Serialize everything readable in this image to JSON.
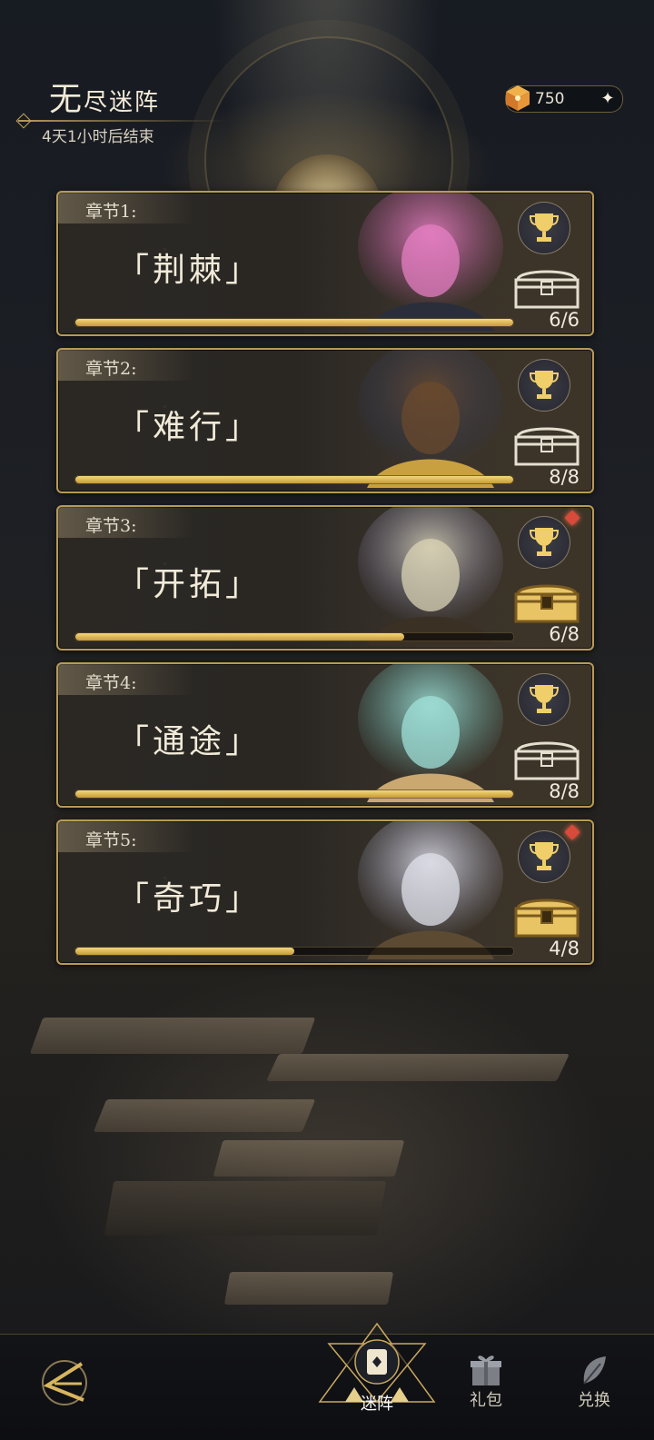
{
  "header": {
    "title_main": "无",
    "title_rest": "尽迷阵",
    "subtitle": "4天1小时后结束"
  },
  "currency": {
    "value": "750",
    "icon": "cube-icon",
    "add_icon": "plus-icon"
  },
  "chapters": [
    {
      "label": "章节1:",
      "name": "「荆棘」",
      "progress_text": "6/6",
      "progress": 1.0,
      "chest_active": false,
      "alert": false
    },
    {
      "label": "章节2:",
      "name": "「难行」",
      "progress_text": "8/8",
      "progress": 1.0,
      "chest_active": false,
      "alert": false
    },
    {
      "label": "章节3:",
      "name": "「开拓」",
      "progress_text": "6/8",
      "progress": 0.75,
      "chest_active": true,
      "alert": true
    },
    {
      "label": "章节4:",
      "name": "「通途」",
      "progress_text": "8/8",
      "progress": 1.0,
      "chest_active": false,
      "alert": false
    },
    {
      "label": "章节5:",
      "name": "「奇巧」",
      "progress_text": "4/8",
      "progress": 0.5,
      "chest_active": true,
      "alert": true
    }
  ],
  "nav": {
    "maze": "迷阵",
    "gift": "礼包",
    "exchange": "兑换"
  },
  "colors": {
    "gold": "#c9a85f",
    "alert": "#d84a3a",
    "progress": "#e2bd5a"
  }
}
